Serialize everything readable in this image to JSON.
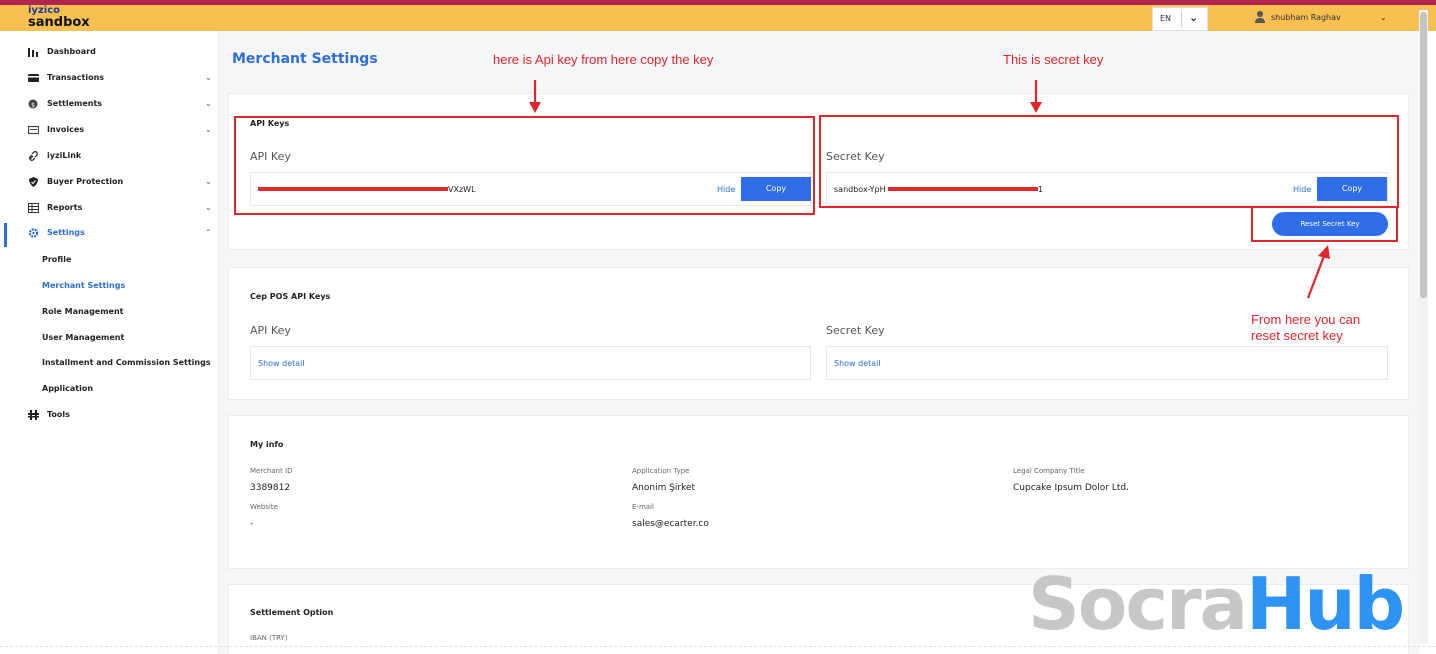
{
  "header": {
    "brand_top": "iyzico",
    "brand_bottom": "sandbox",
    "language": "EN",
    "user_name": "shubham Raghav"
  },
  "sidebar": {
    "items": [
      {
        "label": "Dashboard",
        "icon": "bar-chart-icon",
        "expandable": false
      },
      {
        "label": "Transactions",
        "icon": "card-icon",
        "expandable": true
      },
      {
        "label": "Settlements",
        "icon": "coin-icon",
        "expandable": true
      },
      {
        "label": "Invoices",
        "icon": "invoice-icon",
        "expandable": true
      },
      {
        "label": "iyziLink",
        "icon": "link-icon",
        "expandable": false
      },
      {
        "label": "Buyer Protection",
        "icon": "shield-icon",
        "expandable": true
      },
      {
        "label": "Reports",
        "icon": "table-icon",
        "expandable": true
      },
      {
        "label": "Settings",
        "icon": "gear-icon",
        "expandable": true,
        "active": true
      }
    ],
    "settings_sub": [
      "Profile",
      "Merchant Settings",
      "Role Management",
      "User Management",
      "Installment and Commission Settings",
      "Application"
    ],
    "tools_label": "Tools"
  },
  "page": {
    "title": "Merchant Settings"
  },
  "api_keys": {
    "section_title": "API Keys",
    "api_key_label": "API Key",
    "api_key_value_visible_end": "VXzWL",
    "secret_key_label": "Secret Key",
    "secret_key_value_visible_start": "sandbox-YpH",
    "secret_key_value_visible_end": "1",
    "hide_label": "Hide",
    "copy_label": "Copy",
    "reset_label": "Reset Secret Key"
  },
  "cep_pos": {
    "section_title": "Cep POS API Keys",
    "api_key_label": "API Key",
    "secret_key_label": "Secret Key",
    "show_detail_label": "Show detail"
  },
  "my_info": {
    "section_title": "My info",
    "merchant_id_label": "Merchant ID",
    "merchant_id": "3389812",
    "application_type_label": "Application Type",
    "application_type": "Anonim Şirket",
    "legal_title_label": "Legal Company Title",
    "legal_title": "Cupcake Ipsum Dolor Ltd.",
    "website_label": "Website",
    "website": "-",
    "email_label": "E-mail",
    "email": "sales@ecarter.co"
  },
  "settlement": {
    "section_title": "Settlement Option",
    "iban_label": "IBAN (TRY)"
  },
  "annotations": {
    "api_note": "here is Api key  from here copy the key",
    "secret_note": "This is secret key",
    "reset_note_line1": "From here you can",
    "reset_note_line2": "reset secret key",
    "color": "#e0262b"
  },
  "watermark": {
    "part1": "Socra",
    "part2": "Hub"
  },
  "colors": {
    "accent": "#2d6fd6",
    "topbar": "#f8bf52",
    "stripe": "#b1264e",
    "button": "#2f6ee6"
  }
}
